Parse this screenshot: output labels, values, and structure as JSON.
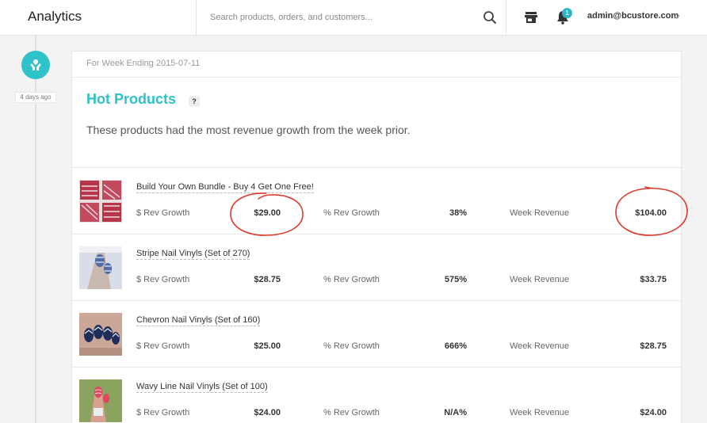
{
  "header": {
    "app_title": "Analytics",
    "search_placeholder": "Search products, orders, and customers...",
    "notification_count": "1",
    "user_email": "admin@bcustore.com"
  },
  "timeline": {
    "event_time": "4 days ago"
  },
  "card": {
    "week_label": "For Week Ending 2015-07-11",
    "title": "Hot Products",
    "help": "?",
    "description": "These products had the most revenue growth from the week prior.",
    "labels": {
      "rev_growth": "$ Rev Growth",
      "pct_growth": "% Rev Growth",
      "week_revenue": "Week Revenue"
    },
    "products": [
      {
        "name": "Build Your Own Bundle - Buy 4 Get One Free!",
        "rev_growth": "$29.00",
        "pct_growth": "38%",
        "week_revenue": "$104.00"
      },
      {
        "name": "Stripe Nail Vinyls (Set of 270)",
        "rev_growth": "$28.75",
        "pct_growth": "575%",
        "week_revenue": "$33.75"
      },
      {
        "name": "Chevron Nail Vinyls (Set of 160)",
        "rev_growth": "$25.00",
        "pct_growth": "666%",
        "week_revenue": "$28.75"
      },
      {
        "name": "Wavy Line Nail Vinyls (Set of 100)",
        "rev_growth": "$24.00",
        "pct_growth": "N/A%",
        "week_revenue": "$24.00"
      }
    ]
  },
  "colors": {
    "accent": "#2ec2c9",
    "annotation": "#e0392b"
  },
  "icons": [
    "search-icon",
    "store-icon",
    "bell-icon",
    "chevron-down-icon",
    "hands-icon",
    "help-icon"
  ]
}
